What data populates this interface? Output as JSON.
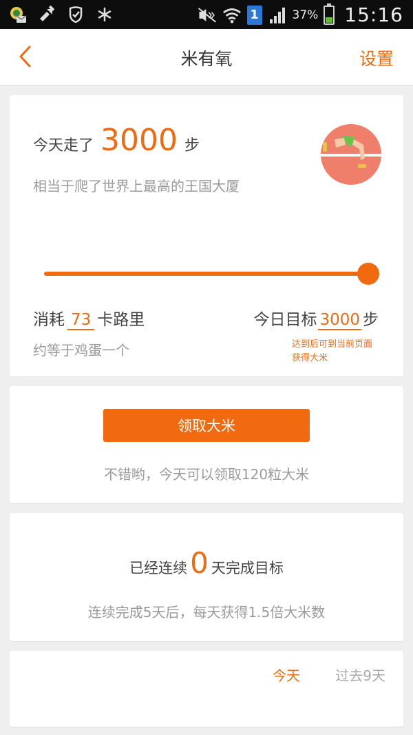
{
  "status_bar": {
    "icons": [
      "app-notification-icon",
      "tool-icon",
      "shield-icon",
      "asterisk-icon",
      "mute-icon",
      "wifi-icon",
      "sim-badge-icon",
      "signal-icon",
      "battery-icon"
    ],
    "sim_badge": "1",
    "battery_percent": "37%",
    "battery_level": 0.37,
    "time": "15:16"
  },
  "header": {
    "title": "米有氧",
    "settings_label": "设置"
  },
  "steps_card": {
    "prefix": "今天走了",
    "steps": "3000",
    "suffix": "步",
    "comparison": "相当于爬了世界上最高的王国大厦",
    "progress": 1.0,
    "calories_prefix": "消耗",
    "calories_value": "73",
    "calories_suffix": "卡路里",
    "calories_equivalent": "约等于鸡蛋一个",
    "goal_prefix": "今日目标",
    "goal_value": "3000",
    "goal_suffix": "步",
    "goal_note": "达到后可到当前页面获得大米"
  },
  "claim_card": {
    "button_label": "领取大米",
    "note": "不错哟，今天可以领取120粒大米"
  },
  "streak_card": {
    "prefix": "已经连续",
    "days": "0",
    "suffix": "天完成目标",
    "note": "连续完成5天后，每天获得1.5倍大米数"
  },
  "history_card": {
    "tab_today": "今天",
    "tab_past": "过去9天"
  },
  "colors": {
    "accent": "#f26a0f",
    "runner_circle": "#ef7f6b",
    "shorts": "#6cc24a"
  }
}
